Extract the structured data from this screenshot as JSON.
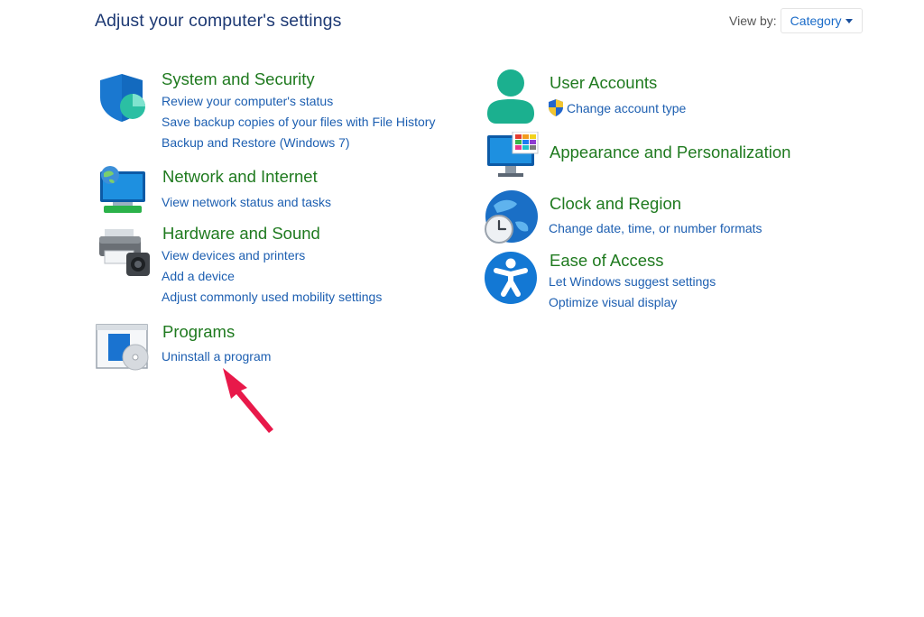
{
  "header": {
    "title": "Adjust your computer's settings",
    "view_by_label": "View by:",
    "view_by_value": "Category"
  },
  "left_categories": [
    {
      "title": "System and Security",
      "icon": "shield-icon",
      "links": [
        "Review your computer's status",
        "Save backup copies of your files with File History",
        "Backup and Restore (Windows 7)"
      ]
    },
    {
      "title": "Network and Internet",
      "icon": "network-globe-icon",
      "links": [
        "View network status and tasks"
      ]
    },
    {
      "title": "Hardware and Sound",
      "icon": "printer-speaker-icon",
      "links": [
        "View devices and printers",
        "Add a device",
        "Adjust commonly used mobility settings"
      ]
    },
    {
      "title": "Programs",
      "icon": "programs-disc-icon",
      "links": [
        "Uninstall a program"
      ]
    }
  ],
  "right_categories": [
    {
      "title": "User Accounts",
      "icon": "user-icon",
      "links": [
        "Change account type"
      ]
    },
    {
      "title": "Appearance and Personalization",
      "icon": "monitor-palette-icon",
      "links": []
    },
    {
      "title": "Clock and Region",
      "icon": "globe-clock-icon",
      "links": [
        "Change date, time, or number formats"
      ]
    },
    {
      "title": "Ease of Access",
      "icon": "accessibility-icon",
      "links": [
        "Let Windows suggest settings",
        "Optimize visual display"
      ]
    }
  ],
  "colors": {
    "title_blue": "#1e3a74",
    "category_green": "#1f7a1f",
    "link_blue": "#1d5fb1",
    "annotation_arrow": "#e8194a"
  }
}
